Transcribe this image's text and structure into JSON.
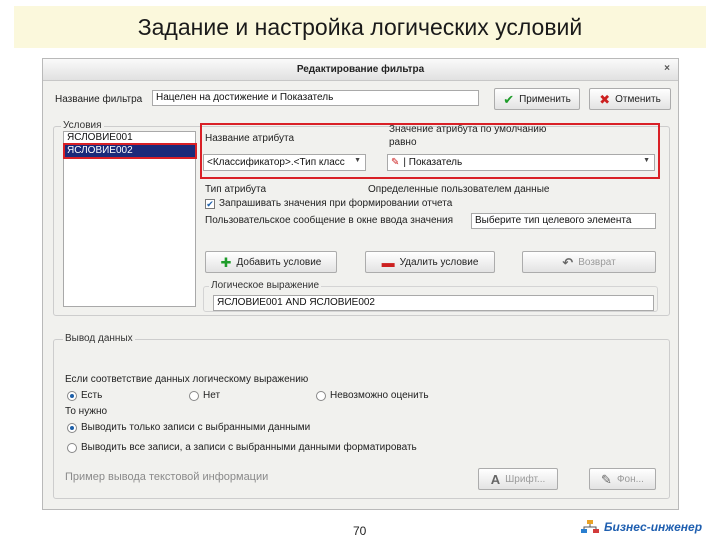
{
  "slide": {
    "title": "Задание и настройка логических условий",
    "page_number": "70",
    "brand": "Бизнес-инженер"
  },
  "dialog": {
    "title": "Редактирование фильтра",
    "close_glyph": "×",
    "filter_name_label": "Название фильтра",
    "filter_name_value": "Нацелен на достижение и Показатель",
    "apply_label": "Применить",
    "cancel_label": "Отменить",
    "conditions_group": "Условия",
    "conditions": [
      "ЯСЛОВИЕ001",
      "ЯСЛОВИЕ002"
    ],
    "selected_condition_index": 1,
    "attr_name_label": "Название атрибута",
    "attr_name_value": "<Классификатор>.<Тип класс",
    "attr_value_label": "Значение атрибута по умолчанию",
    "attr_value_label_2": "равно",
    "attr_value_value": "| Показатель",
    "attr_type_label": "Тип атрибута",
    "user_data_label": "Определенные пользователем данные",
    "request_checkbox_label": "Запрашивать значения при формировании отчета",
    "request_checked": true,
    "user_msg_label": "Пользовательское сообщение в окне ввода значения",
    "user_msg_value": "Выберите тип целевого элемента",
    "add_condition_label": "Добавить условие",
    "delete_condition_label": "Удалить условие",
    "return_label": "Возврат",
    "logic_label": "Логическое выражение",
    "logic_value": "ЯСЛОВИЕ001 AND ЯСЛОВИЕ002",
    "output_group": "Вывод данных",
    "if_match_label": "Если соответствие данных логическому выражению",
    "radio_exists": "Есть",
    "radio_no": "Нет",
    "radio_impossible": "Невозможно оценить",
    "then_label": "То нужно",
    "radio_only_selected": "Выводить только записи с выбранными данными",
    "radio_all_format": "Выводить все записи, а записи с выбранными данными форматировать",
    "example_label": "Пример вывода текстовой информации",
    "font_button_label": "Шрифт...",
    "background_button_label": "Фон..."
  },
  "colors": {
    "highlight_frame": "#d92026",
    "selection": "#1b2a7a",
    "title_bg": "#fbf8dc",
    "brand": "#1f5fb0"
  },
  "icons": [
    "check-icon",
    "cross-icon",
    "plus-icon",
    "minus-icon",
    "undo-icon",
    "brush-icon",
    "font-icon",
    "dropdown-arrow-icon",
    "close-icon",
    "brand-logo-icon"
  ]
}
